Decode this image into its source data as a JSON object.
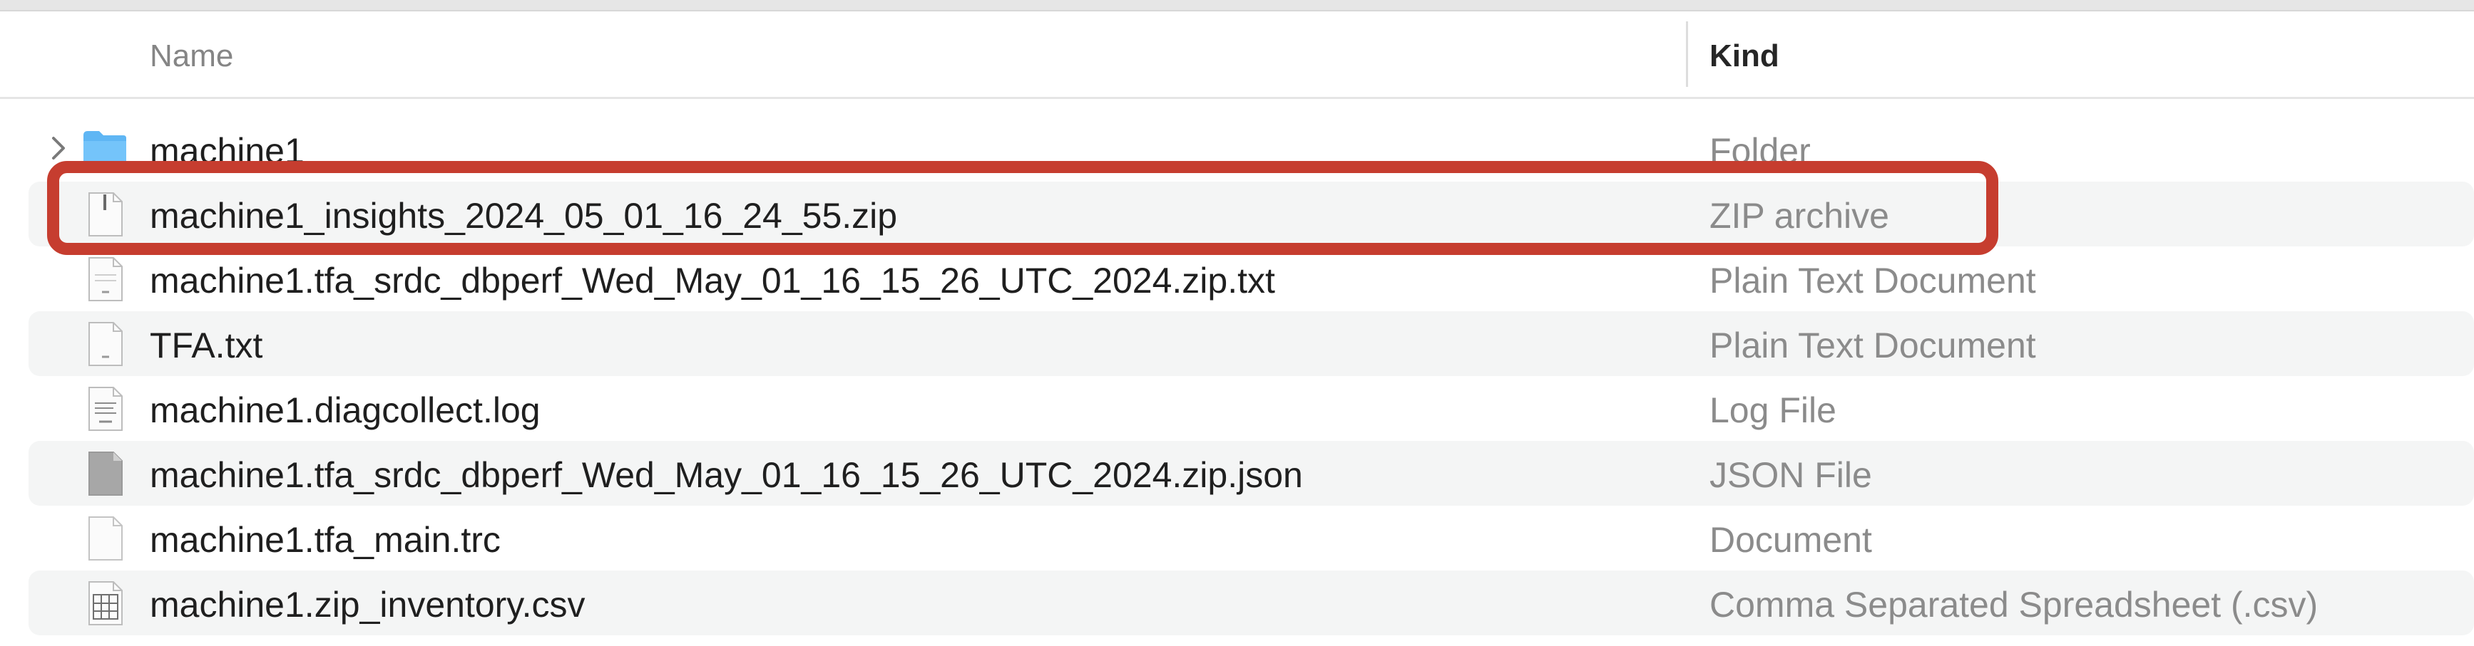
{
  "columns": {
    "name": "Name",
    "kind": "Kind"
  },
  "rows": [
    {
      "name": "machine1",
      "kind": "Folder",
      "icon": "folder-icon",
      "expandable": true
    },
    {
      "name": "machine1_insights_2024_05_01_16_24_55.zip",
      "kind": "ZIP archive",
      "icon": "zip-file-icon",
      "selected_highlight": true
    },
    {
      "name": "machine1.tfa_srdc_dbperf_Wed_May_01_16_15_26_UTC_2024.zip.txt",
      "kind": "Plain Text Document",
      "icon": "text-file-icon"
    },
    {
      "name": "TFA.txt",
      "kind": "Plain Text Document",
      "icon": "text-file-icon"
    },
    {
      "name": "machine1.diagcollect.log",
      "kind": "Log File",
      "icon": "log-file-icon"
    },
    {
      "name": "machine1.tfa_srdc_dbperf_Wed_May_01_16_15_26_UTC_2024.zip.json",
      "kind": "JSON File",
      "icon": "json-file-icon"
    },
    {
      "name": "machine1.tfa_main.trc",
      "kind": "Document",
      "icon": "document-icon"
    },
    {
      "name": "machine1.zip_inventory.csv",
      "kind": "Comma Separated Spreadsheet (.csv)",
      "icon": "csv-file-icon"
    }
  ],
  "colors": {
    "highlight": "#c63d2f",
    "folder": "#5fb6f4",
    "row_alt": "#f4f5f5"
  }
}
